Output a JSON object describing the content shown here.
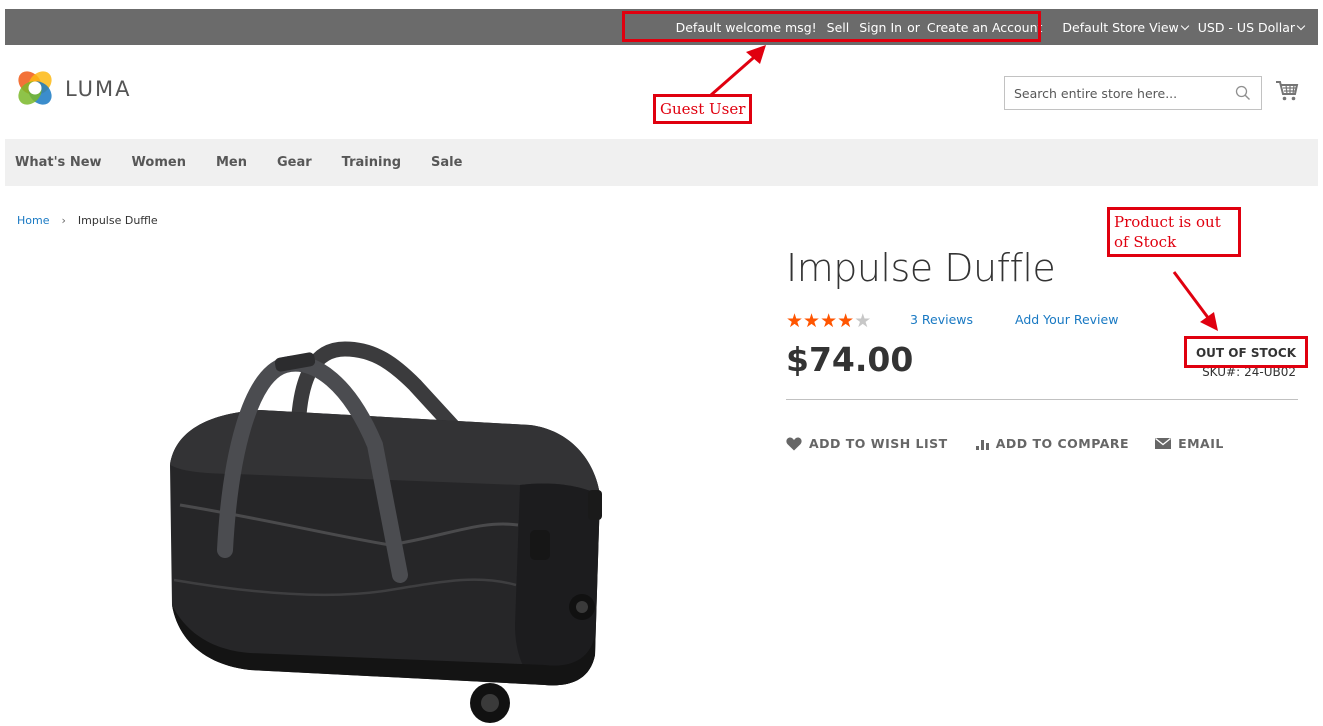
{
  "top_bar": {
    "welcome": "Default welcome msg!",
    "sell": "Sell",
    "sign_in": "Sign In",
    "or": "or",
    "create_account": "Create an Account",
    "store_view": "Default Store View",
    "currency": "USD - US Dollar"
  },
  "header": {
    "logo_text": "LUMA",
    "search_placeholder": "Search entire store here..."
  },
  "nav": [
    "What's New",
    "Women",
    "Men",
    "Gear",
    "Training",
    "Sale"
  ],
  "breadcrumb": {
    "home": "Home",
    "current": "Impulse Duffle"
  },
  "product": {
    "name": "Impulse Duffle",
    "rating_stars": 4,
    "rating_max": 5,
    "reviews_label": "3  Reviews",
    "add_review_label": "Add Your Review",
    "price": "$74.00",
    "stock": "OUT OF STOCK",
    "sku_label": "SKU#:",
    "sku": "24-UB02",
    "actions": {
      "wishlist": "ADD TO WISH LIST",
      "compare": "ADD TO COMPARE",
      "email": "EMAIL"
    }
  },
  "annotations": {
    "guest_user": "Guest User",
    "out_of_stock_line1": "Product is out",
    "out_of_stock_line2": "of Stock"
  },
  "colors": {
    "topbar": "#6b6b6b",
    "link": "#1979c3",
    "star": "#ff5501",
    "annotation": "#e0000f"
  }
}
